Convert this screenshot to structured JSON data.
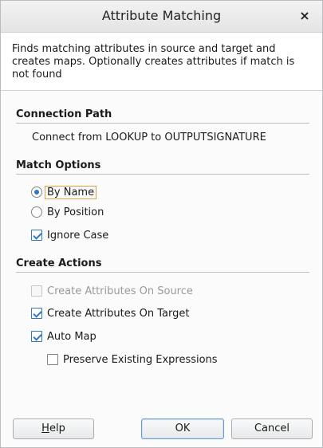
{
  "dialog": {
    "title": "Attribute Matching",
    "close_glyph": "×",
    "description": "Finds matching attributes in source and target and creates maps.  Optionally creates attributes if match is not found"
  },
  "connection_path": {
    "heading": "Connection Path",
    "text": "Connect from LOOKUP to OUTPUTSIGNATURE"
  },
  "match_options": {
    "heading": "Match Options",
    "by_name": "By Name",
    "by_position": "By Position",
    "selected": "By Name",
    "ignore_case": {
      "label": "Ignore Case",
      "checked": true
    }
  },
  "create_actions": {
    "heading": "Create Actions",
    "on_source": {
      "label": "Create Attributes On Source",
      "checked": false,
      "enabled": false
    },
    "on_target": {
      "label": "Create Attributes On Target",
      "checked": true,
      "enabled": true
    },
    "auto_map": {
      "label": "Auto Map",
      "checked": true,
      "enabled": true
    },
    "preserve": {
      "label": "Preserve Existing Expressions",
      "checked": false,
      "enabled": true
    }
  },
  "buttons": {
    "help_mnemonic": "H",
    "help_rest": "elp",
    "ok": "OK",
    "cancel": "Cancel"
  },
  "colors": {
    "accent": "#2e78c8",
    "focus": "#e0a040",
    "disabled_text": "#9a9a9a"
  }
}
